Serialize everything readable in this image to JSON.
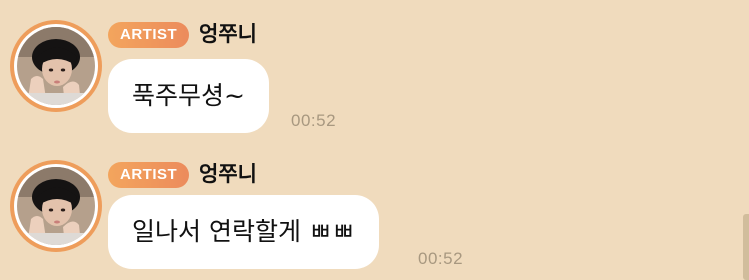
{
  "messages": [
    {
      "badge": "ARTIST",
      "sender": "엉쭈니",
      "text": "푹주무셩~",
      "time": "00:52"
    },
    {
      "badge": "ARTIST",
      "sender": "엉쭈니",
      "text": "일나서 연락할게 ㅃㅃ",
      "time": "00:52"
    }
  ],
  "colors": {
    "background": "#f0dbbd",
    "accent": "#ee9d5b",
    "bubble": "#ffffff",
    "timestamp": "#a89880"
  },
  "icons": {
    "avatar": "profile-photo"
  }
}
